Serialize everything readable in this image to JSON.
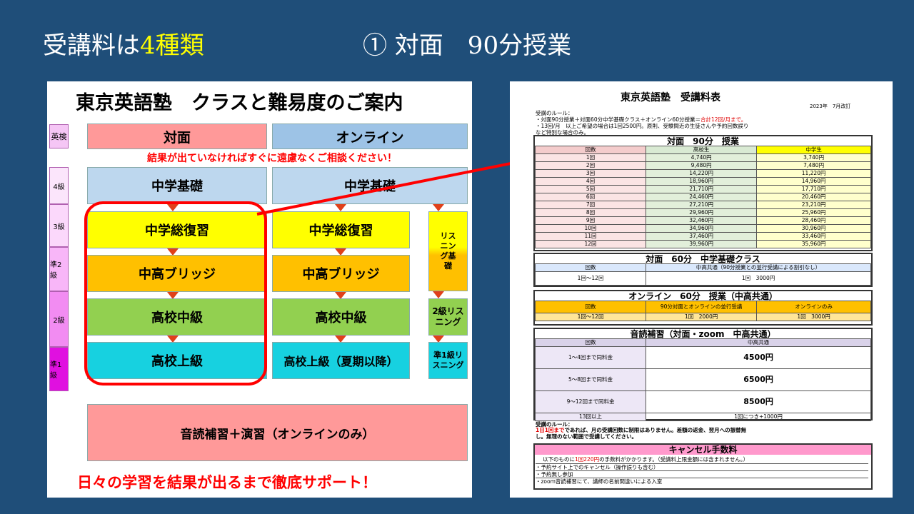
{
  "slide": {
    "title_prefix": "受講料は",
    "title_highlight": "4種類",
    "subtitle": "① 対面　90分授業"
  },
  "left": {
    "title": "東京英語塾　クラスと難易度のご案内",
    "eiken_header": "英検",
    "levels": [
      "4級",
      "3級",
      "準2級",
      "2級",
      "準1級"
    ],
    "col_taimen": "対面",
    "col_online": "オンライン",
    "notice": "結果が出ていなければすぐに遠慮なくご相談ください！",
    "taimen": [
      "中学基礎",
      "中学総復習",
      "中高ブリッジ",
      "高校中級",
      "高校上級"
    ],
    "online": [
      "中学基礎",
      "中学総復習",
      "中高ブリッジ",
      "高校中級",
      "高校上級（夏期以降）"
    ],
    "listening": [
      "リスニング基礎",
      "2級リスニング",
      "準1級リスニング"
    ],
    "ondoku": "音読補習＋演習（オンラインのみ）",
    "footer": "日々の学習を結果が出るまで徹底サポート！"
  },
  "right": {
    "title": "東京英語塾　受講料表",
    "date": "2023年　7月改訂",
    "rules_head": "受講のルール：",
    "rule1_a": "・対面90分授業＋対面60分中学基礎クラス＋オンライン60分授業＝",
    "rule1_b": "合計12回/月まで。",
    "rule2": "・13回/月　以上ご希望の場合は1回2500円。原則、受験間近の生徒さんや予約回数誤り",
    "rule3": "など特別な場合のみ。",
    "sec1_title": "対面　90分　授業",
    "sec1_headers": [
      "回数",
      "高校生",
      "中学生"
    ],
    "sec1_rows": [
      [
        "1回",
        "4,740円",
        "3,740円"
      ],
      [
        "2回",
        "9,480円",
        "7,480円"
      ],
      [
        "3回",
        "14,220円",
        "11,220円"
      ],
      [
        "4回",
        "18,960円",
        "14,960円"
      ],
      [
        "5回",
        "21,710円",
        "17,710円"
      ],
      [
        "6回",
        "24,460円",
        "20,460円"
      ],
      [
        "7回",
        "27,210円",
        "23,210円"
      ],
      [
        "8回",
        "29,960円",
        "25,960円"
      ],
      [
        "9回",
        "32,460円",
        "28,460円"
      ],
      [
        "10回",
        "34,960円",
        "30,960円"
      ],
      [
        "11回",
        "37,460円",
        "33,460円"
      ],
      [
        "12回",
        "39,960円",
        "35,960円"
      ]
    ],
    "sec2_title": "対面　60分　中学基礎クラス",
    "sec2_headers": [
      "回数",
      "中高共通（90分授業との並行受講による割引なし）"
    ],
    "sec2_row": [
      "1回〜12回",
      "1回　3000円"
    ],
    "sec3_title": "オンライン　60分　授業（中高共通）",
    "sec3_headers": [
      "回数",
      "90分対面とオンラインの並行受講",
      "オンラインのみ"
    ],
    "sec3_row": [
      "1回〜12回",
      "1回　2000円",
      "1回　3000円"
    ],
    "sec4_title": "音読補習（対面・zoom　中高共通）",
    "sec4_headers": [
      "回数",
      "中高共通"
    ],
    "sec4_rows": [
      [
        "1〜4回まで同料金",
        "4500円"
      ],
      [
        "5〜8回まで同料金",
        "6500円"
      ],
      [
        "9〜12回まで同料金",
        "8500円"
      ],
      [
        "13回以上",
        "1回につき+1000円"
      ]
    ],
    "rules2_head": "受講のルール：",
    "rules2_a_red": "1日1回まで",
    "rules2_a": "であれば、月の受講回数に制限はありません。差額の返金、翌月への振替無",
    "rules2_b": "し。無理のない範囲で受講してください。",
    "sec5_title": "キャンセル手数料",
    "sec5_line1_a": "以下のものに",
    "sec5_line1_red": "1回220円",
    "sec5_line1_b": "の手数料がかかります。（受講料上限金額には含まれません。）",
    "sec5_items": [
      "・予約サイト上でのキャンセル（操作誤りも含む）",
      "・予約無し参加",
      "・zoom音読補習にて、講師の名前間違いによる入室"
    ]
  },
  "colors": {
    "background": "#1f4e79",
    "taimen_header": "#ff9999",
    "online_header": "#9dc3e6",
    "kiso": "#bdd7ee",
    "soufukushu": "#ffff00",
    "bridge": "#ffc000",
    "chukyu": "#92d050",
    "joukyu": "#17d1e0",
    "ondoku": "#ff9999",
    "highlight_frame": "#ff0000"
  }
}
